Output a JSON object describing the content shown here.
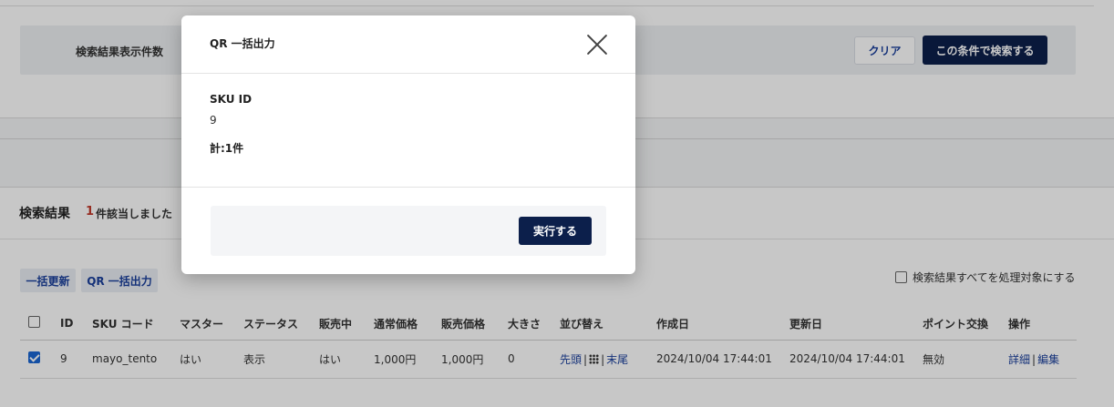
{
  "search": {
    "display_count_label": "検索結果表示件数",
    "clear_label": "クリア",
    "search_label": "この条件で検索する"
  },
  "results": {
    "title": "検索結果",
    "count": "1",
    "count_suffix": "件該当しました",
    "bulk_update_label": "一括更新",
    "qr_bulk_label": "QR 一括出力",
    "all_target_label": "検索結果すべてを処理対象にする",
    "columns": [
      "ID",
      "SKU コード",
      "マスター",
      "ステータス",
      "販売中",
      "通常価格",
      "販売価格",
      "大きさ",
      "並び替え",
      "作成日",
      "更新日",
      "ポイント交換",
      "操作"
    ],
    "rows": [
      {
        "checked": true,
        "id": "9",
        "sku_code": "mayo_tento",
        "master": "はい",
        "status": "表示",
        "on_sale": "はい",
        "regular_price": "1,000円",
        "sale_price": "1,000円",
        "size": "0",
        "sort_first": "先頭",
        "sort_sep1": "|",
        "sort_sep2": "|",
        "sort_last": "末尾",
        "created": "2024/10/04 17:44:01",
        "updated": "2024/10/04 17:44:01",
        "points": "無効",
        "action_detail": "詳細",
        "action_sep": "|",
        "action_edit": "編集"
      }
    ]
  },
  "modal": {
    "title": "QR 一括出力",
    "sku_label": "SKU ID",
    "sku_value": "9",
    "total": "計:1件",
    "run_label": "実行する"
  },
  "colors": {
    "primary": "#0c1f4b",
    "link": "#1a3f9c",
    "count": "#c0392b"
  }
}
